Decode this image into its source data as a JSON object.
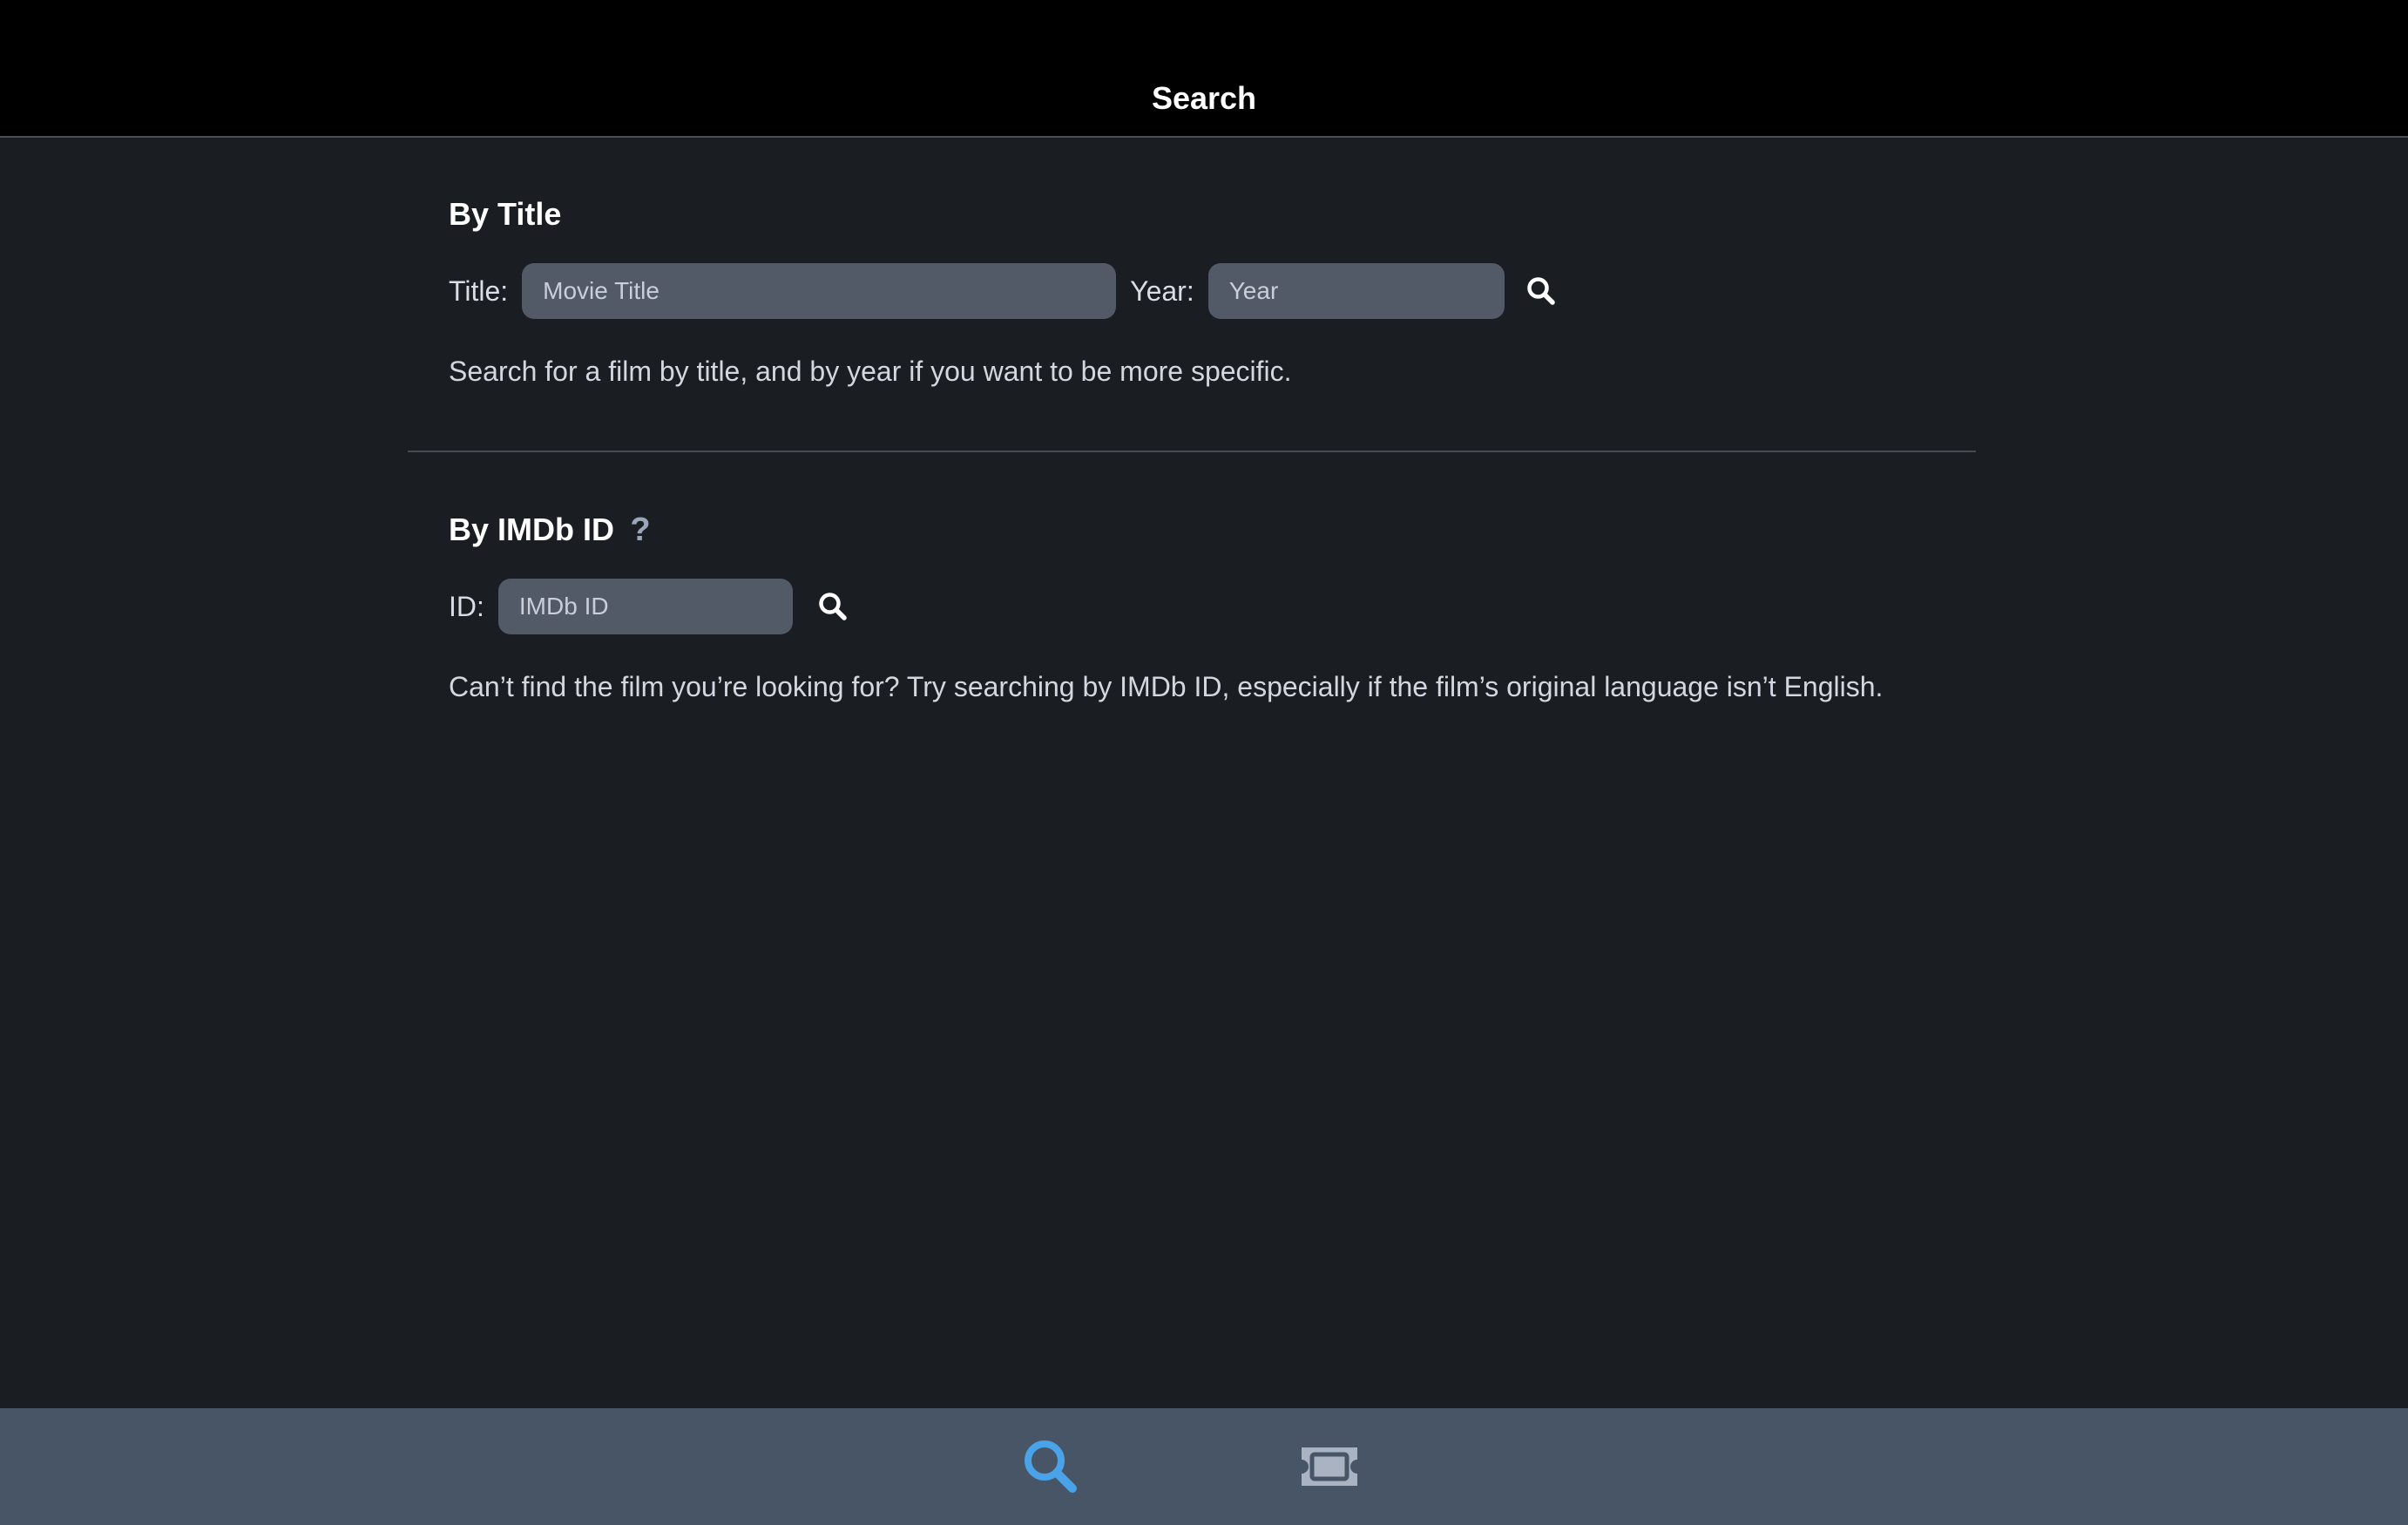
{
  "header": {
    "title": "Search"
  },
  "by_title": {
    "heading": "By Title",
    "title_label": "Title:",
    "title_placeholder": "Movie Title",
    "title_value": "",
    "year_label": "Year:",
    "year_placeholder": "Year",
    "year_value": "",
    "search_icon": "search-icon",
    "helper": "Search for a film by title, and by year if you want to be more specific."
  },
  "by_imdb": {
    "heading": "By IMDb ID",
    "help_icon": "question-mark-icon",
    "help_glyph": "?",
    "id_label": "ID:",
    "id_placeholder": "IMDb ID",
    "id_value": "",
    "search_icon": "search-icon",
    "helper": "Can’t find the film you’re looking for? Try searching by IMDb ID, especially if the film’s original language isn’t English."
  },
  "tabbar": {
    "tabs": [
      {
        "icon": "search-icon",
        "active": true
      },
      {
        "icon": "ticket-icon",
        "active": false
      }
    ],
    "active_color": "#4aa3e8",
    "inactive_color": "#a9b3c1"
  },
  "colors": {
    "background": "#1a1d22",
    "header": "#000000",
    "input": "#525a68",
    "tabbar": "#485566"
  }
}
